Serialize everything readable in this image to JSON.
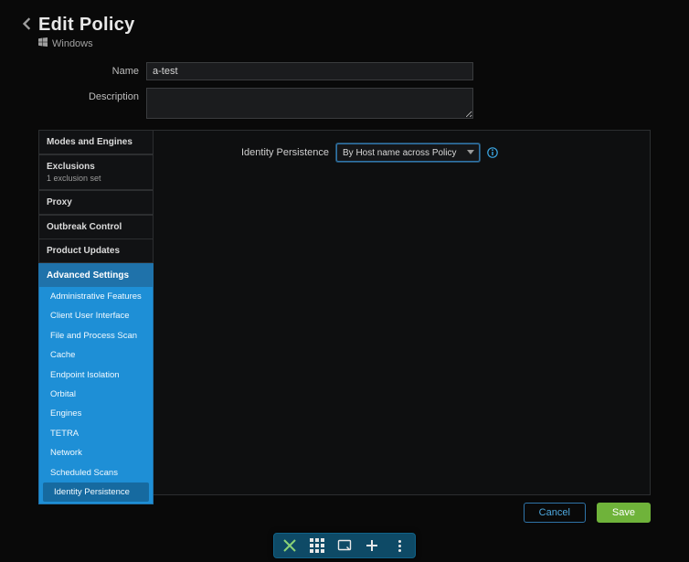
{
  "header": {
    "title": "Edit Policy",
    "platform": "Windows"
  },
  "form": {
    "name_label": "Name",
    "name_value": "a-test",
    "description_label": "Description",
    "description_value": ""
  },
  "sidebar": {
    "modes_label": "Modes and Engines",
    "exclusions_label": "Exclusions",
    "exclusions_sub": "1 exclusion set",
    "proxy_label": "Proxy",
    "outbreak_label": "Outbreak Control",
    "updates_label": "Product Updates",
    "advanced_header": "Advanced Settings",
    "advanced_items": [
      {
        "label": "Administrative Features"
      },
      {
        "label": "Client User Interface"
      },
      {
        "label": "File and Process Scan"
      },
      {
        "label": "Cache"
      },
      {
        "label": "Endpoint Isolation"
      },
      {
        "label": "Orbital"
      },
      {
        "label": "Engines"
      },
      {
        "label": "TETRA"
      },
      {
        "label": "Network"
      },
      {
        "label": "Scheduled Scans"
      },
      {
        "label": "Identity Persistence"
      }
    ]
  },
  "content": {
    "identity_persistence_label": "Identity Persistence",
    "identity_persistence_value": "By Host name across Policy"
  },
  "footer": {
    "cancel": "Cancel",
    "save": "Save"
  }
}
